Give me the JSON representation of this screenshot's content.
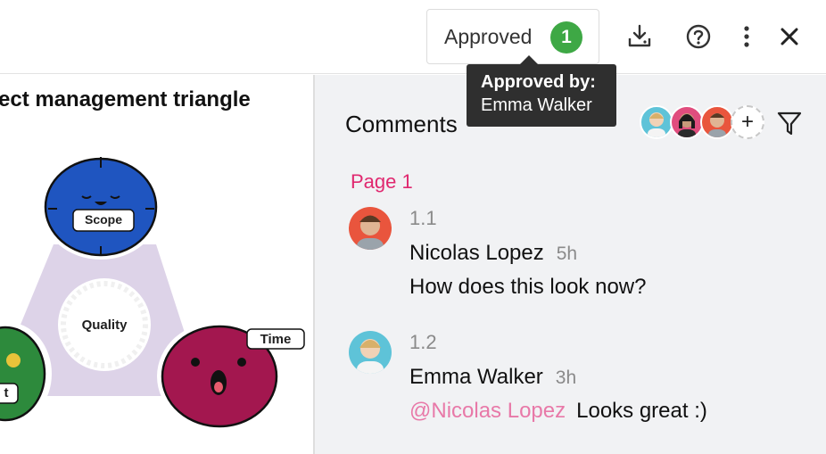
{
  "toolbar": {
    "approved_label": "Approved",
    "approved_count": "1",
    "download_icon": "download-icon",
    "help_icon": "help-icon",
    "more_icon": "more-vertical-icon",
    "close_icon": "close-icon"
  },
  "tooltip": {
    "title": "Approved by:",
    "name": "Emma Walker"
  },
  "slide": {
    "title": "ect management triangle",
    "labels": {
      "scope": "Scope",
      "quality": "Quality",
      "time": "Time",
      "cost_partial": "t"
    }
  },
  "comments_panel": {
    "title": "Comments",
    "add_participant": "+",
    "filter_icon": "filter-icon",
    "page_label": "Page 1",
    "comments": [
      {
        "number": "1.1",
        "author": "Nicolas Lopez",
        "time": "5h",
        "mention": "",
        "text": "How does this look now?"
      },
      {
        "number": "1.2",
        "author": "Emma Walker",
        "time": "3h",
        "mention": "@Nicolas Lopez",
        "text": "Looks great  :)"
      }
    ]
  },
  "colors": {
    "approved_badge": "#3ea845",
    "page_label": "#e0286f",
    "mention": "#e879a8",
    "panel_bg": "#f1f2f4",
    "tooltip_bg": "#2f2f2f"
  }
}
